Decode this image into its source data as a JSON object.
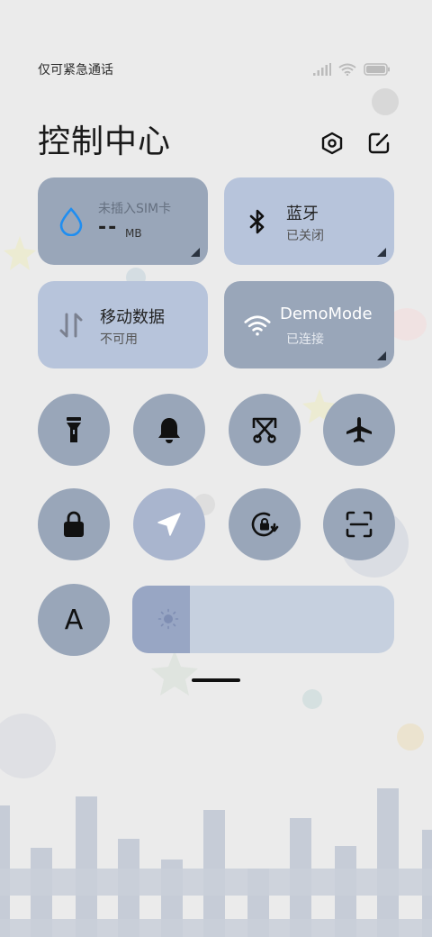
{
  "status_bar": {
    "carrier_text": "仅可紧急通话",
    "signal_icon": "signal-bars-icon",
    "wifi_icon": "wifi-icon",
    "battery_icon": "battery-icon"
  },
  "header": {
    "title": "控制中心",
    "settings_icon": "settings-hex-icon",
    "edit_icon": "edit-icon"
  },
  "tiles": {
    "data_usage": {
      "title": "未插入SIM卡",
      "value": "--",
      "unit": "MB",
      "icon": "water-drop-icon"
    },
    "bluetooth": {
      "title": "蓝牙",
      "status": "已关闭",
      "icon": "bluetooth-icon"
    },
    "mobile_data": {
      "title": "移动数据",
      "status": "不可用",
      "icon": "mobile-data-arrows-icon"
    },
    "wifi": {
      "title": "DemoMode",
      "status": "已连接",
      "icon": "wifi-icon"
    }
  },
  "toggles_row1": [
    {
      "name": "flashlight",
      "icon": "flashlight-icon"
    },
    {
      "name": "ringer",
      "icon": "bell-icon"
    },
    {
      "name": "screenshot",
      "icon": "scissors-icon"
    },
    {
      "name": "airplane",
      "icon": "airplane-icon"
    }
  ],
  "toggles_row2": [
    {
      "name": "lock-screen",
      "icon": "lock-icon"
    },
    {
      "name": "location",
      "icon": "location-arrow-icon"
    },
    {
      "name": "rotation-lock",
      "icon": "rotation-lock-icon"
    },
    {
      "name": "scanner",
      "icon": "scan-icon"
    }
  ],
  "row3": {
    "font_button_label": "A",
    "brightness": {
      "level": 0.22,
      "icon": "brightness-icon"
    }
  },
  "colors": {
    "tile_active": "#99a6b9",
    "tile_inactive": "#b7c4db",
    "background": "#ebebeb"
  }
}
